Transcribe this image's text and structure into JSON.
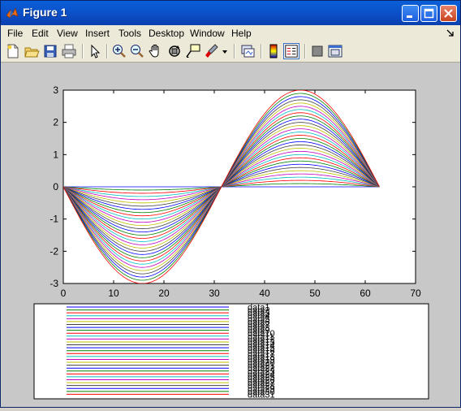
{
  "window": {
    "title": "Figure 1"
  },
  "menu": [
    {
      "label": "File"
    },
    {
      "label": "Edit"
    },
    {
      "label": "View"
    },
    {
      "label": "Insert"
    },
    {
      "label": "Tools"
    },
    {
      "label": "Desktop"
    },
    {
      "label": "Window"
    },
    {
      "label": "Help"
    }
  ],
  "toolbar": {
    "buttons": [
      "new-figure-icon",
      "open-file-icon",
      "save-icon",
      "print-icon",
      "edit-plot-arrow-icon",
      "zoom-in-icon",
      "zoom-out-icon",
      "pan-hand-icon",
      "rotate-3d-icon",
      "data-cursor-icon",
      "brush-icon",
      "brush-dropdown-icon",
      "link-plot-icon",
      "colorbar-icon",
      "legend-icon",
      "hide-plot-tools-icon",
      "show-plot-tools-icon"
    ]
  },
  "chart_data": {
    "type": "line",
    "x_range": [
      0,
      62.8
    ],
    "series_count": 31,
    "amplitude_max": 3,
    "amplitude_step": 0.1,
    "function": "y = -a*sin(x/10), a = 0,0.1,...,3",
    "xlim": [
      0,
      70
    ],
    "ylim": [
      -3,
      3
    ],
    "xticks": [
      "0",
      "10",
      "20",
      "30",
      "40",
      "50",
      "60",
      "70"
    ],
    "yticks": [
      "-3",
      "-2",
      "-1",
      "0",
      "1",
      "2",
      "3"
    ],
    "colors": [
      "#0000ff",
      "#008000",
      "#ff0000",
      "#00bfbf",
      "#bf00bf",
      "#bfbf00",
      "#404040"
    ],
    "legend": {
      "entries": [
        "data1",
        "data2",
        "data3",
        "data4",
        "data5",
        "data6",
        "data7",
        "data8",
        "data9",
        "data10",
        "data11",
        "data12",
        "data13",
        "data14",
        "data15",
        "data16",
        "data17",
        "data18",
        "data19",
        "data20",
        "data21",
        "data22",
        "data23",
        "data24",
        "data25",
        "data26",
        "data27",
        "data28",
        "data29",
        "data30",
        "data31"
      ]
    }
  }
}
